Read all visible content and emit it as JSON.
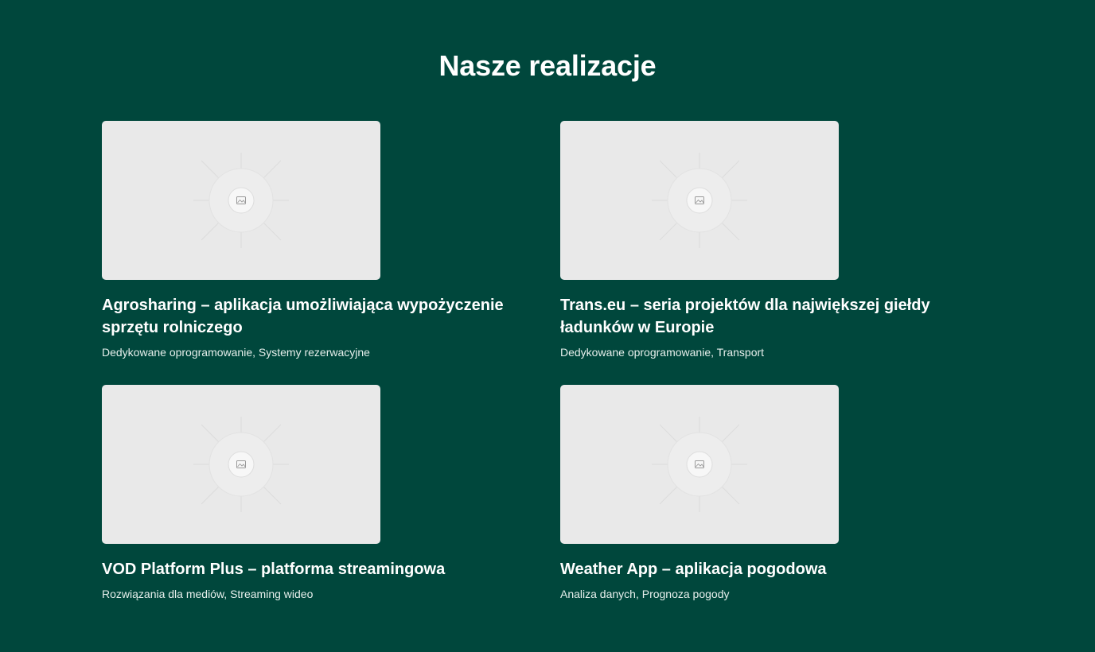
{
  "page": {
    "title": "Nasze realizacje",
    "background_color": "#00473c",
    "placeholder_color": "#e9e9e9"
  },
  "projects": [
    {
      "title": "Agrosharing – aplikacja umożliwiająca wypożyczenie sprzętu rolniczego",
      "tags": "Dedykowane oprogramowanie, Systemy rezerwacyjne",
      "image_icon": "image-placeholder-icon"
    },
    {
      "title": "Trans.eu – seria projektów dla największej giełdy ładunków w Europie",
      "tags": "Dedykowane oprogramowanie, Transport",
      "image_icon": "image-placeholder-icon"
    },
    {
      "title": "VOD Platform Plus – platforma streamingowa",
      "tags": "Rozwiązania dla mediów, Streaming wideo",
      "image_icon": "image-placeholder-icon"
    },
    {
      "title": "Weather App – aplikacja pogodowa",
      "tags": "Analiza danych, Prognoza pogody",
      "image_icon": "image-placeholder-icon"
    }
  ]
}
